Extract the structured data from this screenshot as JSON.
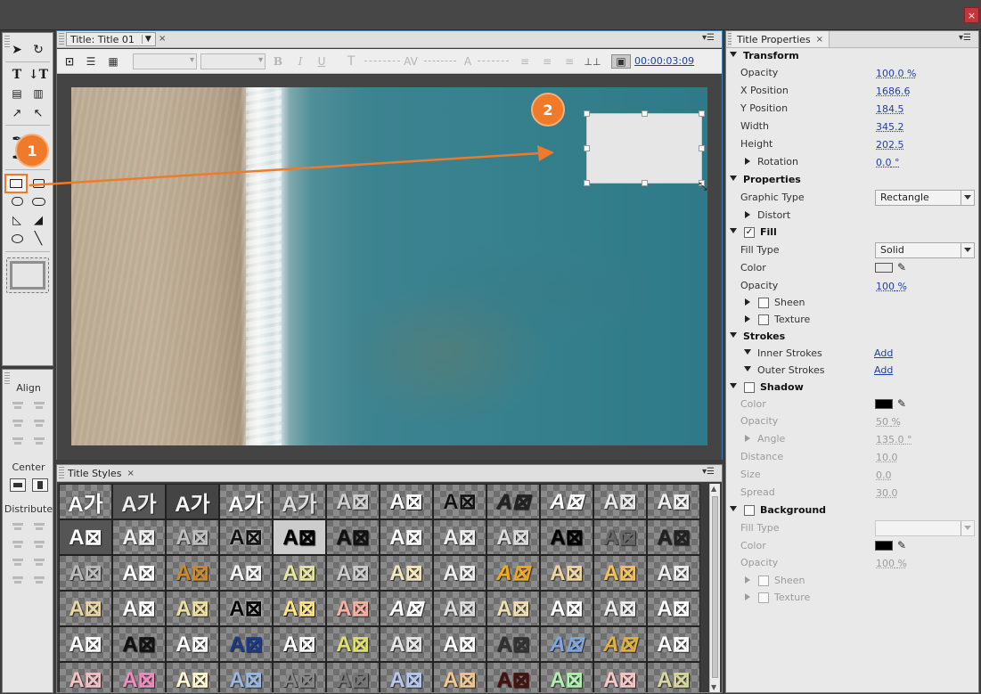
{
  "window": {
    "close_glyph": "×"
  },
  "title_panel": {
    "tab_label": "Title: Title 01",
    "tab_close": "×",
    "timecode": "00:00:03:09"
  },
  "align_panel": {
    "align_label": "Align",
    "center_label": "Center",
    "distribute_label": "Distribute"
  },
  "annotations": {
    "step1": "1",
    "step2": "2",
    "arrow_color": "#ee7a2a"
  },
  "styles_panel": {
    "tab_label": "Title Styles",
    "tab_close": "×",
    "swatches": [
      "A가",
      "A가",
      "A가",
      "A가",
      "A가",
      "A⊠",
      "A⊠",
      "A⊠",
      "A⊠",
      "A⊠",
      "A⊠",
      "A⊠",
      "A⊠",
      "A⊠",
      "A⊠",
      "A⊠",
      "A⊠",
      "A⊠",
      "A⊠",
      "A⊠",
      "A⊠",
      "A⊠",
      "A⊠",
      "A⊠",
      "A⊠",
      "A⊠",
      "A⊠",
      "A⊠",
      "A⊠",
      "A⊠",
      "A⊠",
      "A⊠",
      "A⊠",
      "A⊠",
      "A⊠",
      "A⊠",
      "A⊠",
      "A⊠",
      "A⊠",
      "A⊠",
      "A⊠",
      "A⊠",
      "A⊠",
      "A⊠",
      "A⊠",
      "A⊠",
      "A⊠",
      "A⊠",
      "A⊠",
      "A⊠",
      "A⊠",
      "A⊠",
      "A⊠",
      "A⊠",
      "A⊠",
      "A⊠",
      "A⊠",
      "A⊠",
      "A⊠",
      "A⊠",
      "A⊠",
      "A⊠",
      "A⊠",
      "A⊠",
      "A⊠",
      "A⊠",
      "A⊠",
      "A⊠",
      "A⊠",
      "A⊠",
      "A⊠",
      "A⊠"
    ]
  },
  "properties": {
    "tab_label": "Title Properties",
    "tab_close": "×",
    "transform": {
      "header": "Transform",
      "opacity_label": "Opacity",
      "opacity_value": "100.0",
      "opacity_unit": "%",
      "x_label": "X Position",
      "x_value": "1686.6",
      "y_label": "Y Position",
      "y_value": "184.5",
      "width_label": "Width",
      "width_value": "345.2",
      "height_label": "Height",
      "height_value": "202.5",
      "rotation_label": "Rotation",
      "rotation_value": "0.0",
      "rotation_unit": "°"
    },
    "props": {
      "header": "Properties",
      "graphic_type_label": "Graphic Type",
      "graphic_type_value": "Rectangle",
      "distort_label": "Distort"
    },
    "fill": {
      "header": "Fill",
      "fill_type_label": "Fill Type",
      "fill_type_value": "Solid",
      "color_label": "Color",
      "color_value": "#e8e8e8",
      "opacity_label": "Opacity",
      "opacity_value": "100",
      "opacity_unit": "%",
      "sheen_label": "Sheen",
      "texture_label": "Texture"
    },
    "strokes": {
      "header": "Strokes",
      "inner_label": "Inner Strokes",
      "inner_action": "Add",
      "outer_label": "Outer Strokes",
      "outer_action": "Add"
    },
    "shadow": {
      "header": "Shadow",
      "color_label": "Color",
      "color_value": "#000000",
      "opacity_label": "Opacity",
      "opacity_value": "50",
      "opacity_unit": "%",
      "angle_label": "Angle",
      "angle_value": "135.0",
      "angle_unit": "°",
      "distance_label": "Distance",
      "distance_value": "10.0",
      "size_label": "Size",
      "size_value": "0.0",
      "spread_label": "Spread",
      "spread_value": "30.0"
    },
    "background": {
      "header": "Background",
      "fill_type_label": "Fill Type",
      "fill_type_value": "",
      "color_label": "Color",
      "color_value": "#000000",
      "opacity_label": "Opacity",
      "opacity_value": "100",
      "opacity_unit": "%",
      "sheen_label": "Sheen",
      "texture_label": "Texture"
    }
  }
}
